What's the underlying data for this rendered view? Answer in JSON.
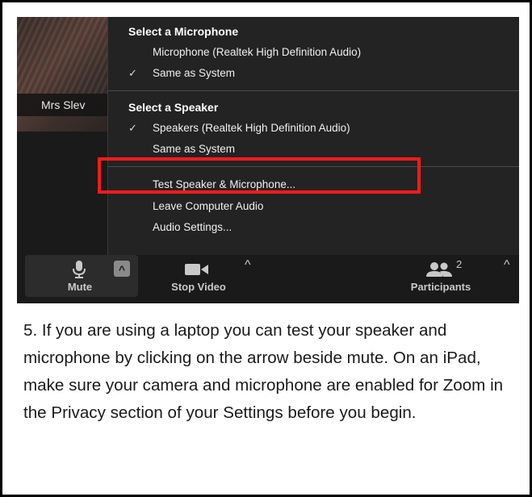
{
  "participant": {
    "name": "Mrs Slev"
  },
  "menu": {
    "mic_heading": "Select a Microphone",
    "mic_items": [
      {
        "label": "Microphone (Realtek High Definition Audio)",
        "checked": false
      },
      {
        "label": "Same as System",
        "checked": true
      }
    ],
    "speaker_heading": "Select a Speaker",
    "speaker_items": [
      {
        "label": "Speakers (Realtek High Definition Audio)",
        "checked": true
      },
      {
        "label": "Same as System",
        "checked": false
      }
    ],
    "actions": [
      {
        "label": "Test Speaker & Microphone...",
        "highlighted": true
      },
      {
        "label": "Leave Computer Audio"
      },
      {
        "label": "Audio Settings..."
      }
    ],
    "check_glyph": "✓"
  },
  "toolbar": {
    "mute_label": "Mute",
    "stop_video_label": "Stop Video",
    "participants_label": "Participants",
    "participants_count": "2",
    "caret_glyph": "^"
  },
  "caption": {
    "text": "5. If you are using a laptop you can test your speaker and microphone by clicking on the arrow beside mute. On an iPad, make sure your camera and microphone are enabled for Zoom in the Privacy section of your Settings before you begin."
  },
  "colors": {
    "highlight": "#ff1a1a",
    "menu_bg": "#232323",
    "toolbar_bg": "#1a1a1a"
  }
}
